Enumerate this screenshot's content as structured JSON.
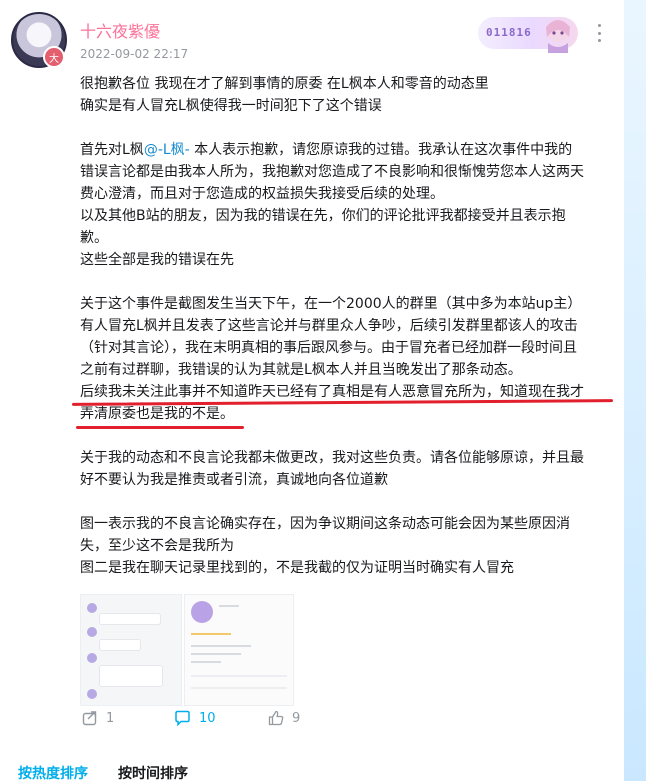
{
  "post": {
    "username": "十六夜紫優",
    "timestamp": "2022-09-02 22:17",
    "avatar_badge": "大",
    "fan_badge_number": "011816",
    "paragraphs": [
      "很抱歉各位 我现在才了解到事情的原委 在L枫本人和零音的动态里",
      "确实是有人冒充L枫使得我一时间犯下了这个错误",
      "",
      "首先对L枫",
      "-L枫- 本人表示抱歉，请您原谅我的过错。我承认在这次事件中我的",
      "错误言论都是由我本人所为，我抱歉对您造成了不良影响和很惭愧劳您本人这两天",
      "费心澄清，而且对于您造成的权益损失我接受后续的处理。",
      "以及其他B站的朋友，因为我的错误在先，你们的评论批评我都接受并且表示抱",
      "歉。",
      "这些全部是我的错误在先",
      "",
      "关于这个事件是截图发生当天下午，在一个2000人的群里（其中多为本站up主）",
      "有人冒充L枫并且发表了这些言论并与群里众人争吵，后续引发群里都该人的攻击",
      "（针对其言论），我在末明真相的事后跟风参与。由于冒充者已经加群一段时间且",
      "之前有过群聊，我错误的认为其就是L枫本人并且当晚发出了那条动态。",
      "后续我未关注此事并不知道昨天已经有了真相是有人恶意冒充所为，知道现在我才",
      "弄清原委也是我的不是。",
      "",
      "关于我的动态和不良言论我都未做更改，我对这些负责。请各位能够原谅，并且最",
      "好不要认为我是推责或者引流，真诚地向各位道歉",
      "",
      "图一表示我的不良言论确实存在，因为争议期间这条动态可能会因为某些原因消",
      "失，至少这不会是我所为",
      "图二是我在聊天记录里找到的，不是我截的仅为证明当时确实有人冒充"
    ],
    "mention": "@-L枫-",
    "mention_prefix": "首先对L枫",
    "mention_suffix": " 本人表示抱歉，请您原谅我的过错。我承认在这次事件中我的"
  },
  "actions": {
    "share_count": "1",
    "comment_count": "10",
    "like_count": "9"
  },
  "sort": {
    "hot": "按热度排序",
    "time": "按时间排序"
  },
  "colors": {
    "username": "#fb7299",
    "accent": "#00aeec",
    "underline": "#e11f2d"
  },
  "icons": [
    "more-icon",
    "share-icon",
    "comment-icon",
    "like-icon"
  ]
}
